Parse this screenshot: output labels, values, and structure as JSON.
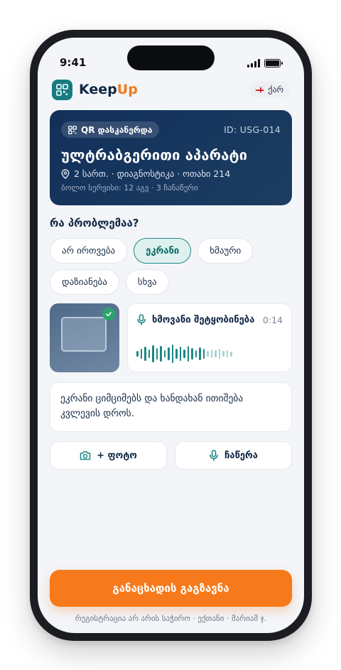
{
  "status_bar": {
    "time": "9:41"
  },
  "header": {
    "app_name_main": "Keep",
    "app_name_accent": "Up",
    "language_label": "ქარ",
    "brand_color": "#167c80",
    "accent_color": "#f07a1c"
  },
  "equipment": {
    "scan_badge": "QR დასკანერდა",
    "id_label": "ID: USG-014",
    "title": "ულტრაბგერითი აპარატი",
    "location": "2 სართ. · დიაგნოსტიკა · ოთახი 214",
    "last_service": "ბოლო სერვისი: 12 აგვ · 3 ჩანაწერი"
  },
  "problem": {
    "question": "რა პრობლემაა?",
    "options": [
      {
        "label": "არ ირთვება",
        "selected": false
      },
      {
        "label": "ეკრანი",
        "selected": true
      },
      {
        "label": "ხმაური",
        "selected": false
      },
      {
        "label": "დაზიანება",
        "selected": false
      },
      {
        "label": "სხვა",
        "selected": false
      }
    ]
  },
  "attachments": {
    "photo_icon": "monitor-photo",
    "photo_attached": true,
    "voice": {
      "title": "ხმოვანი შეტყობინება",
      "duration": "0:14",
      "played_fraction": 0.72
    }
  },
  "note": {
    "text": "ეკრანი ციმციმებს და ხანდახან ითიშება კვლევის დროს."
  },
  "actions": {
    "add_photo_label": "+ ფოტო",
    "record_label": "ჩაწერა"
  },
  "submit": {
    "label": "განაცხადის გაგზავნა",
    "color": "#f67a1b"
  },
  "footer": {
    "text": "რეგისტრაცია არ არის საჭირო · ექთანი · მარიამ ჯ."
  }
}
